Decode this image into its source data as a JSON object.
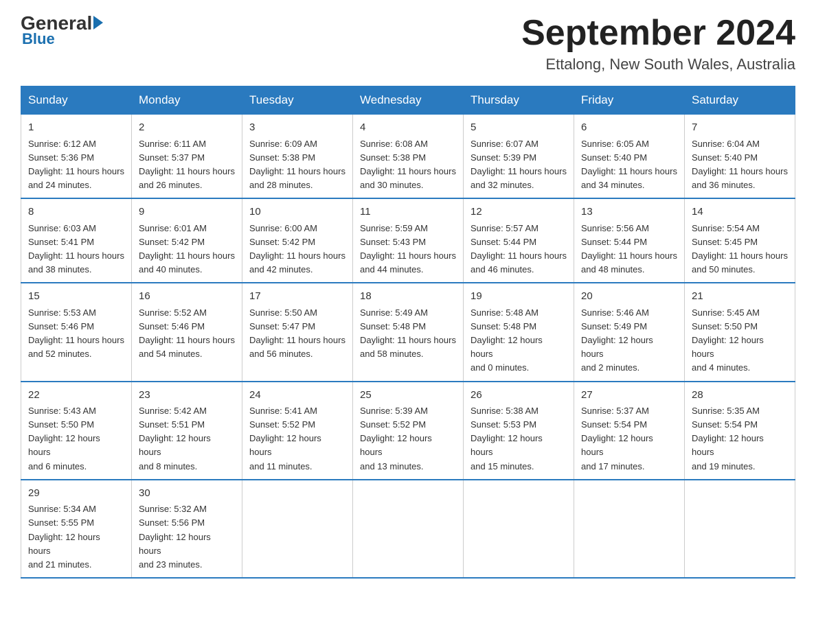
{
  "header": {
    "logo_general": "General",
    "logo_blue": "Blue",
    "month_title": "September 2024",
    "location": "Ettalong, New South Wales, Australia"
  },
  "days_of_week": [
    "Sunday",
    "Monday",
    "Tuesday",
    "Wednesday",
    "Thursday",
    "Friday",
    "Saturday"
  ],
  "weeks": [
    [
      {
        "day": "1",
        "sunrise": "6:12 AM",
        "sunset": "5:36 PM",
        "daylight": "11 hours and 24 minutes."
      },
      {
        "day": "2",
        "sunrise": "6:11 AM",
        "sunset": "5:37 PM",
        "daylight": "11 hours and 26 minutes."
      },
      {
        "day": "3",
        "sunrise": "6:09 AM",
        "sunset": "5:38 PM",
        "daylight": "11 hours and 28 minutes."
      },
      {
        "day": "4",
        "sunrise": "6:08 AM",
        "sunset": "5:38 PM",
        "daylight": "11 hours and 30 minutes."
      },
      {
        "day": "5",
        "sunrise": "6:07 AM",
        "sunset": "5:39 PM",
        "daylight": "11 hours and 32 minutes."
      },
      {
        "day": "6",
        "sunrise": "6:05 AM",
        "sunset": "5:40 PM",
        "daylight": "11 hours and 34 minutes."
      },
      {
        "day": "7",
        "sunrise": "6:04 AM",
        "sunset": "5:40 PM",
        "daylight": "11 hours and 36 minutes."
      }
    ],
    [
      {
        "day": "8",
        "sunrise": "6:03 AM",
        "sunset": "5:41 PM",
        "daylight": "11 hours and 38 minutes."
      },
      {
        "day": "9",
        "sunrise": "6:01 AM",
        "sunset": "5:42 PM",
        "daylight": "11 hours and 40 minutes."
      },
      {
        "day": "10",
        "sunrise": "6:00 AM",
        "sunset": "5:42 PM",
        "daylight": "11 hours and 42 minutes."
      },
      {
        "day": "11",
        "sunrise": "5:59 AM",
        "sunset": "5:43 PM",
        "daylight": "11 hours and 44 minutes."
      },
      {
        "day": "12",
        "sunrise": "5:57 AM",
        "sunset": "5:44 PM",
        "daylight": "11 hours and 46 minutes."
      },
      {
        "day": "13",
        "sunrise": "5:56 AM",
        "sunset": "5:44 PM",
        "daylight": "11 hours and 48 minutes."
      },
      {
        "day": "14",
        "sunrise": "5:54 AM",
        "sunset": "5:45 PM",
        "daylight": "11 hours and 50 minutes."
      }
    ],
    [
      {
        "day": "15",
        "sunrise": "5:53 AM",
        "sunset": "5:46 PM",
        "daylight": "11 hours and 52 minutes."
      },
      {
        "day": "16",
        "sunrise": "5:52 AM",
        "sunset": "5:46 PM",
        "daylight": "11 hours and 54 minutes."
      },
      {
        "day": "17",
        "sunrise": "5:50 AM",
        "sunset": "5:47 PM",
        "daylight": "11 hours and 56 minutes."
      },
      {
        "day": "18",
        "sunrise": "5:49 AM",
        "sunset": "5:48 PM",
        "daylight": "11 hours and 58 minutes."
      },
      {
        "day": "19",
        "sunrise": "5:48 AM",
        "sunset": "5:48 PM",
        "daylight": "12 hours and 0 minutes."
      },
      {
        "day": "20",
        "sunrise": "5:46 AM",
        "sunset": "5:49 PM",
        "daylight": "12 hours and 2 minutes."
      },
      {
        "day": "21",
        "sunrise": "5:45 AM",
        "sunset": "5:50 PM",
        "daylight": "12 hours and 4 minutes."
      }
    ],
    [
      {
        "day": "22",
        "sunrise": "5:43 AM",
        "sunset": "5:50 PM",
        "daylight": "12 hours and 6 minutes."
      },
      {
        "day": "23",
        "sunrise": "5:42 AM",
        "sunset": "5:51 PM",
        "daylight": "12 hours and 8 minutes."
      },
      {
        "day": "24",
        "sunrise": "5:41 AM",
        "sunset": "5:52 PM",
        "daylight": "12 hours and 11 minutes."
      },
      {
        "day": "25",
        "sunrise": "5:39 AM",
        "sunset": "5:52 PM",
        "daylight": "12 hours and 13 minutes."
      },
      {
        "day": "26",
        "sunrise": "5:38 AM",
        "sunset": "5:53 PM",
        "daylight": "12 hours and 15 minutes."
      },
      {
        "day": "27",
        "sunrise": "5:37 AM",
        "sunset": "5:54 PM",
        "daylight": "12 hours and 17 minutes."
      },
      {
        "day": "28",
        "sunrise": "5:35 AM",
        "sunset": "5:54 PM",
        "daylight": "12 hours and 19 minutes."
      }
    ],
    [
      {
        "day": "29",
        "sunrise": "5:34 AM",
        "sunset": "5:55 PM",
        "daylight": "12 hours and 21 minutes."
      },
      {
        "day": "30",
        "sunrise": "5:32 AM",
        "sunset": "5:56 PM",
        "daylight": "12 hours and 23 minutes."
      },
      null,
      null,
      null,
      null,
      null
    ]
  ],
  "labels": {
    "sunrise": "Sunrise:",
    "sunset": "Sunset:",
    "daylight": "Daylight:"
  }
}
